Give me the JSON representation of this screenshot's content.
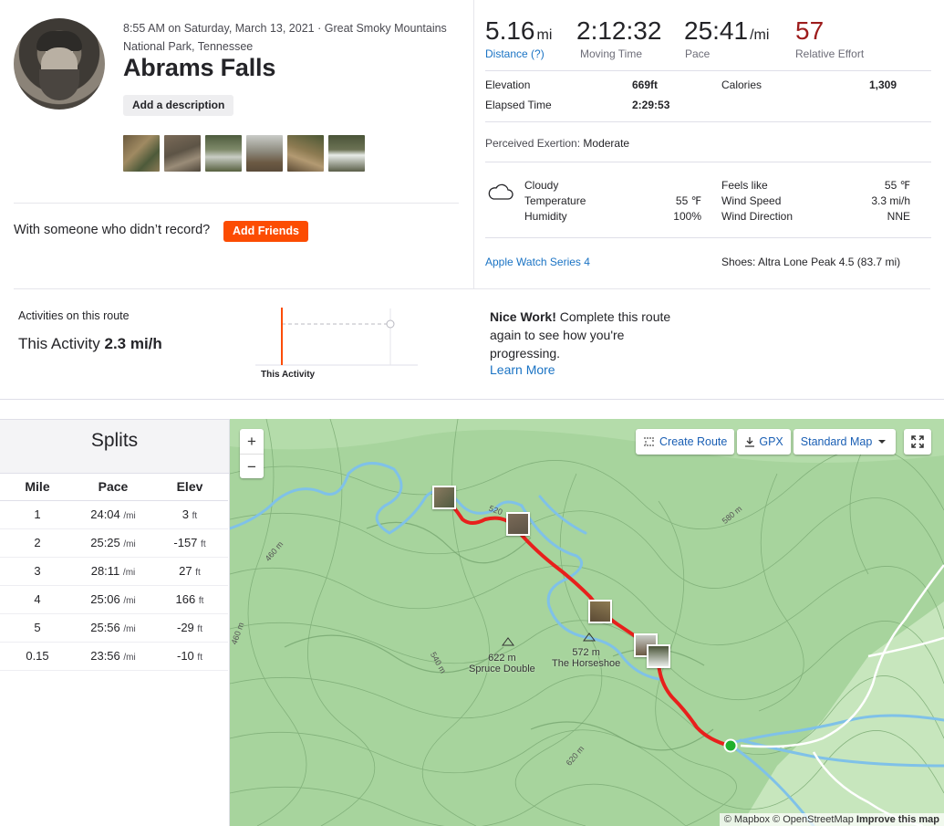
{
  "activity": {
    "meta": "8:55 AM on Saturday, March 13, 2021 · Great Smoky Mountains National Park, Tennessee",
    "title": "Abrams Falls",
    "add_description": "Add a description",
    "with_someone": "With someone who didn’t record?",
    "add_friends": "Add Friends"
  },
  "stats": {
    "distance": {
      "value": "5.16",
      "unit": "mi",
      "label": "Distance (?)"
    },
    "moving_time": {
      "value": "2:12:32",
      "label": "Moving Time"
    },
    "pace": {
      "value": "25:41",
      "unit": "/mi",
      "label": "Pace"
    },
    "effort": {
      "value": "57",
      "label": "Relative Effort"
    },
    "elevation": {
      "label": "Elevation",
      "value": "669ft"
    },
    "elapsed": {
      "label": "Elapsed Time",
      "value": "2:29:53"
    },
    "calories": {
      "label": "Calories",
      "value": "1,309"
    },
    "perceived_label": "Perceived Exertion:",
    "perceived_value": "Moderate"
  },
  "weather": {
    "icon": "cloud-icon",
    "condition": "Cloudy",
    "temperature_label": "Temperature",
    "temperature": "55 ℉",
    "humidity_label": "Humidity",
    "humidity": "100%",
    "feels_like_label": "Feels like",
    "feels_like": "55 ℉",
    "wind_speed_label": "Wind Speed",
    "wind_speed": "3.3 mi/h",
    "wind_dir_label": "Wind Direction",
    "wind_dir": "NNE"
  },
  "device": "Apple Watch Series 4",
  "shoes": "Shoes: Altra Lone Peak 4.5 (83.7 mi)",
  "route": {
    "title": "Activities on this route",
    "this_prefix": "This Activity",
    "this_speed": "2.3 mi/h",
    "axis_label": "This Activity",
    "nice_bold": "Nice Work!",
    "nice_text": " Complete this route again to see how you're progressing.",
    "learn_more": "Learn More"
  },
  "splits": {
    "title": "Splits",
    "headers": [
      "Mile",
      "Pace",
      "Elev"
    ],
    "rows": [
      {
        "mile": "1",
        "pace": "24:04",
        "pace_unit": "/mi",
        "elev": "3",
        "elev_unit": "ft"
      },
      {
        "mile": "2",
        "pace": "25:25",
        "pace_unit": "/mi",
        "elev": "-157",
        "elev_unit": "ft"
      },
      {
        "mile": "3",
        "pace": "28:11",
        "pace_unit": "/mi",
        "elev": "27",
        "elev_unit": "ft"
      },
      {
        "mile": "4",
        "pace": "25:06",
        "pace_unit": "/mi",
        "elev": "166",
        "elev_unit": "ft"
      },
      {
        "mile": "5",
        "pace": "25:56",
        "pace_unit": "/mi",
        "elev": "-29",
        "elev_unit": "ft"
      },
      {
        "mile": "0.15",
        "pace": "23:56",
        "pace_unit": "/mi",
        "elev": "-10",
        "elev_unit": "ft"
      }
    ]
  },
  "map": {
    "zoom_in": "+",
    "zoom_out": "−",
    "create_route": "Create Route",
    "gpx": "GPX",
    "map_style": "Standard Map",
    "attribution_1": "© Mapbox © OpenStreetMap",
    "attribution_2": "Improve this map",
    "peak1_elev": "622 m",
    "peak1_name": "Spruce Double",
    "peak2_elev": "572 m",
    "peak2_name": "The Horseshoe",
    "contours": [
      "520",
      "580 m",
      "460 m",
      "460 m",
      "540 m",
      "620 m"
    ],
    "route_color": "#e8201c",
    "start_color": "#1eb02d"
  },
  "colors": {
    "accent": "#fc4c02",
    "link": "#1a73c4",
    "effort": "#9d1c1c"
  }
}
